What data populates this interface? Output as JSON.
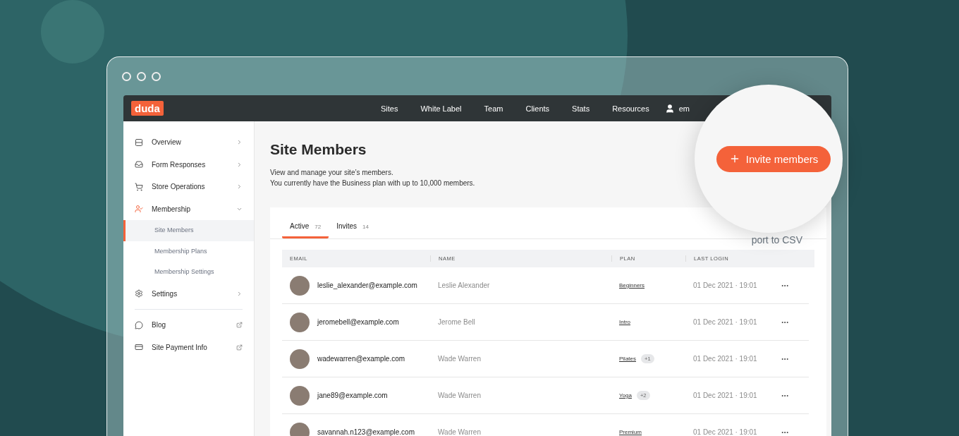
{
  "logo": "duda",
  "nav": {
    "items": [
      "Sites",
      "White Label",
      "Team",
      "Clients",
      "Stats",
      "Resources"
    ],
    "user": "em"
  },
  "sidebar": {
    "items": [
      {
        "label": "Overview",
        "kind": "section",
        "expanded": false,
        "selected": false
      },
      {
        "label": "Form Responses",
        "kind": "section",
        "expanded": false,
        "selected": false
      },
      {
        "label": "Store Operations",
        "kind": "section",
        "expanded": false,
        "selected": false
      },
      {
        "label": "Membership",
        "kind": "section",
        "expanded": true,
        "selected": true,
        "children": [
          {
            "label": "Site Members",
            "selected": true
          },
          {
            "label": "Membership Plans",
            "selected": false
          },
          {
            "label": "Membership Settings",
            "selected": false
          }
        ]
      },
      {
        "label": "Settings",
        "kind": "section",
        "expanded": false,
        "selected": false
      },
      {
        "kind": "divider"
      },
      {
        "label": "Blog",
        "kind": "external",
        "selected": false
      },
      {
        "label": "Site Payment Info",
        "kind": "external",
        "selected": false
      }
    ]
  },
  "page": {
    "title": "Site Members",
    "description": [
      "View and manage your site’s members.",
      "You currently have the Business plan with up to 10,000 members."
    ],
    "invite_button": "Invite members",
    "export_link": "port to CSV"
  },
  "tabs": [
    {
      "label": "Active",
      "count": "72",
      "selected": true
    },
    {
      "label": "Invites",
      "count": "14",
      "selected": false
    }
  ],
  "table": {
    "columns": [
      "EMAIL",
      "NAME",
      "PLAN",
      "LAST LOGIN"
    ],
    "rows": [
      {
        "email": "leslie_alexander@example.com",
        "name": "Leslie Alexander",
        "plan": "Beginners",
        "last_login": "01 Dec 2021 · 19:01"
      },
      {
        "email": "jeromebell@example.com",
        "name": "Jerome Bell",
        "plan": "Intro",
        "last_login": "01 Dec 2021 · 19:01"
      },
      {
        "email": "wadewarren@example.com",
        "name": "Wade Warren",
        "plan": "Pilates",
        "extra": "+1",
        "last_login": "01 Dec 2021 · 19:01"
      },
      {
        "email": "jane89@example.com",
        "name": "Wade Warren",
        "plan": "Yoga",
        "extra": "+2",
        "last_login": "01 Dec 2021 · 19:01"
      },
      {
        "email": "savannah.n123@example.com",
        "name": "Wade Warren",
        "plan": "Premium",
        "last_login": "01 Dec 2021 · 19:01"
      }
    ]
  }
}
